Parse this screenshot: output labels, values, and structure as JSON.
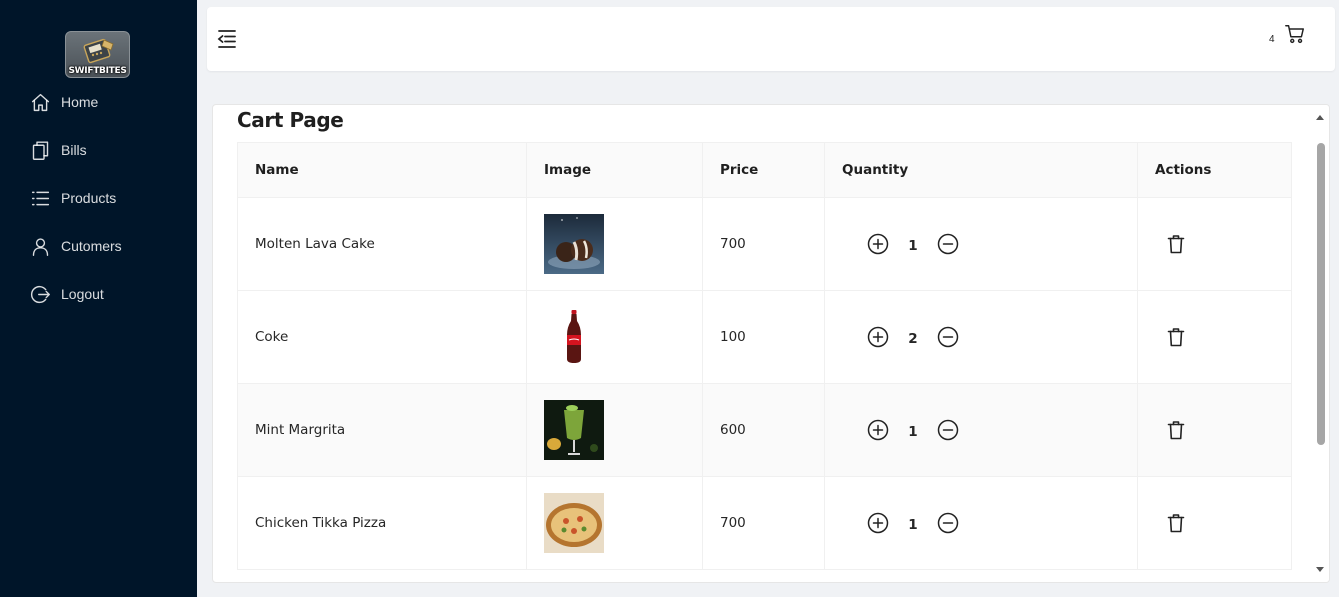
{
  "brand": {
    "name": "SWIFTBITES"
  },
  "sidebar": {
    "items": [
      {
        "label": "Home",
        "icon": "home-icon"
      },
      {
        "label": "Bills",
        "icon": "bills-icon"
      },
      {
        "label": "Products",
        "icon": "list-icon"
      },
      {
        "label": "Cutomers",
        "icon": "user-icon"
      },
      {
        "label": "Logout",
        "icon": "logout-icon"
      }
    ]
  },
  "header": {
    "cart_count": "4",
    "menu_toggle_icon": "menu-fold-icon",
    "cart_icon": "shopping-cart-icon"
  },
  "page": {
    "title": "Cart Page"
  },
  "table": {
    "columns": [
      "Name",
      "Image",
      "Price",
      "Quantity",
      "Actions"
    ],
    "rows": [
      {
        "name": "Molten Lava Cake",
        "image": "molten-lava-cake-photo",
        "price": "700",
        "quantity": "1"
      },
      {
        "name": "Coke",
        "image": "coke-bottle-photo",
        "price": "100",
        "quantity": "2"
      },
      {
        "name": "Mint Margrita",
        "image": "mint-margrita-photo",
        "price": "600",
        "quantity": "1"
      },
      {
        "name": "Chicken Tikka Pizza",
        "image": "chicken-tikka-pizza-photo",
        "price": "700",
        "quantity": "1"
      }
    ]
  },
  "colors": {
    "sidebar_bg": "#001529",
    "page_bg": "#f0f2f5",
    "header_bg": "#ffffff"
  }
}
